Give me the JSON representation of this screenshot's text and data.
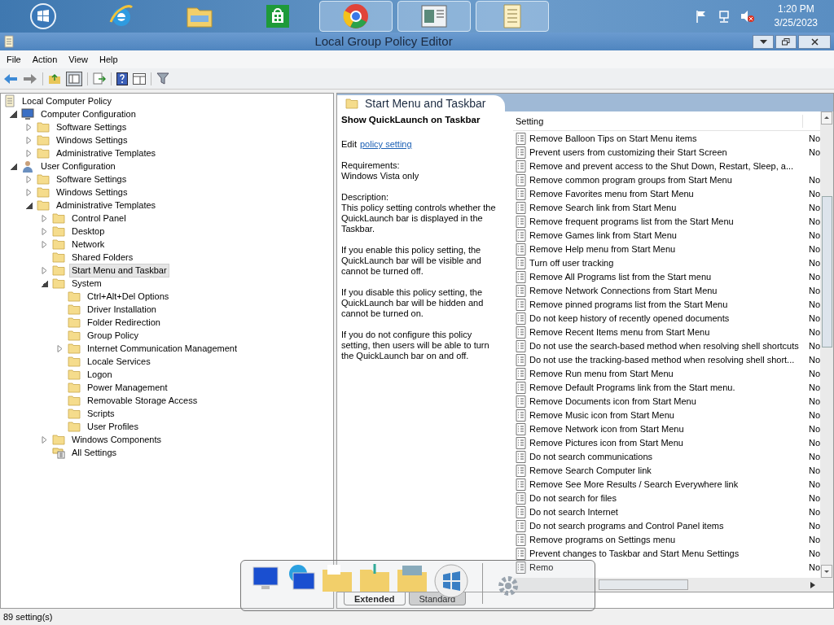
{
  "taskbar": {
    "apps": [
      {
        "kind": "orb",
        "selected": false
      },
      {
        "kind": "browser-e",
        "selected": false
      },
      {
        "kind": "folder",
        "selected": false
      },
      {
        "kind": "store",
        "selected": false
      },
      {
        "kind": "chrome",
        "selected": true
      },
      {
        "kind": "window",
        "selected": true
      },
      {
        "kind": "document",
        "selected": true
      }
    ],
    "time": "1:20 PM",
    "date": "3/25/2023"
  },
  "window": {
    "title": "Local Group Policy Editor"
  },
  "menu": [
    "File",
    "Action",
    "View",
    "Help"
  ],
  "tree": [
    {
      "label": "Local Computer Policy",
      "kind": "policy",
      "selected": false,
      "children": [
        {
          "label": "Computer Configuration",
          "kind": "computer",
          "expandable": true,
          "expanded": true,
          "selected": false,
          "children": [
            {
              "label": "Software Settings",
              "kind": "folder",
              "expandable": true,
              "expanded": false,
              "selected": false
            },
            {
              "label": "Windows Settings",
              "kind": "folder",
              "expandable": true,
              "expanded": false,
              "selected": false
            },
            {
              "label": "Administrative Templates",
              "kind": "folder",
              "expandable": true,
              "expanded": false,
              "selected": false
            }
          ]
        },
        {
          "label": "User Configuration",
          "kind": "user",
          "expandable": true,
          "expanded": true,
          "selected": false,
          "children": [
            {
              "label": "Software Settings",
              "kind": "folder",
              "expandable": true,
              "expanded": false,
              "selected": false
            },
            {
              "label": "Windows Settings",
              "kind": "folder",
              "expandable": true,
              "expanded": false,
              "selected": false
            },
            {
              "label": "Administrative Templates",
              "kind": "folder",
              "expandable": true,
              "expanded": true,
              "selected": false,
              "children": [
                {
                  "label": "Control Panel",
                  "kind": "folder",
                  "expandable": true,
                  "expanded": false,
                  "selected": false
                },
                {
                  "label": "Desktop",
                  "kind": "folder",
                  "expandable": true,
                  "expanded": false,
                  "selected": false
                },
                {
                  "label": "Network",
                  "kind": "folder",
                  "expandable": true,
                  "expanded": false,
                  "selected": false
                },
                {
                  "label": "Shared Folders",
                  "kind": "folder",
                  "expandable": false,
                  "expanded": false,
                  "selected": false
                },
                {
                  "label": "Start Menu and Taskbar",
                  "kind": "folder",
                  "expandable": true,
                  "expanded": false,
                  "selected": true
                },
                {
                  "label": "System",
                  "kind": "folder",
                  "expandable": true,
                  "expanded": true,
                  "selected": false,
                  "children": [
                    {
                      "label": "Ctrl+Alt+Del Options",
                      "kind": "folder",
                      "expandable": false,
                      "expanded": false,
                      "selected": false
                    },
                    {
                      "label": "Driver Installation",
                      "kind": "folder",
                      "expandable": false,
                      "expanded": false,
                      "selected": false
                    },
                    {
                      "label": "Folder Redirection",
                      "kind": "folder",
                      "expandable": false,
                      "expanded": false,
                      "selected": false
                    },
                    {
                      "label": "Group Policy",
                      "kind": "folder",
                      "expandable": false,
                      "expanded": false,
                      "selected": false
                    },
                    {
                      "label": "Internet Communication Management",
                      "kind": "folder",
                      "expandable": true,
                      "expanded": false,
                      "selected": false
                    },
                    {
                      "label": "Locale Services",
                      "kind": "folder",
                      "expandable": false,
                      "expanded": false,
                      "selected": false
                    },
                    {
                      "label": "Logon",
                      "kind": "folder",
                      "expandable": false,
                      "expanded": false,
                      "selected": false
                    },
                    {
                      "label": "Power Management",
                      "kind": "folder",
                      "expandable": false,
                      "expanded": false,
                      "selected": false
                    },
                    {
                      "label": "Removable Storage Access",
                      "kind": "folder",
                      "expandable": false,
                      "expanded": false,
                      "selected": false
                    },
                    {
                      "label": "Scripts",
                      "kind": "folder",
                      "expandable": false,
                      "expanded": false,
                      "selected": false
                    },
                    {
                      "label": "User Profiles",
                      "kind": "folder",
                      "expandable": false,
                      "expanded": false,
                      "selected": false
                    }
                  ]
                },
                {
                  "label": "Windows Components",
                  "kind": "folder",
                  "expandable": true,
                  "expanded": false,
                  "selected": false
                },
                {
                  "label": "All Settings",
                  "kind": "settings",
                  "expandable": false,
                  "expanded": false,
                  "selected": false
                }
              ]
            }
          ]
        }
      ]
    }
  ],
  "pane": {
    "title": "Start Menu and Taskbar",
    "detail": {
      "heading": "Show QuickLaunch on Taskbar",
      "edit_prefix": "Edit",
      "edit_link": "policy setting ",
      "requirements_label": "Requirements:",
      "requirements": "Windows Vista only",
      "description_label": "Description:",
      "paragraphs": [
        "This policy setting controls whether the QuickLaunch bar is displayed in the Taskbar.",
        "If you enable this policy setting, the QuickLaunch bar will be visible and cannot be turned off.",
        "If you disable this policy setting, the QuickLaunch bar will be hidden and cannot be turned on.",
        "If you do not configure this policy setting, then users will be able to turn the QuickLaunch bar on and off."
      ]
    },
    "columns": [
      "Setting"
    ],
    "rows": [
      {
        "setting": "Remove Balloon Tips on Start Menu items",
        "state": "No"
      },
      {
        "setting": "Prevent users from customizing their Start Screen",
        "state": "No"
      },
      {
        "setting": "Remove and prevent access to the Shut Down, Restart, Sleep, a..."
      },
      {
        "setting": "Remove common program groups from Start Menu",
        "state": "No"
      },
      {
        "setting": "Remove Favorites menu from Start Menu",
        "state": "No"
      },
      {
        "setting": "Remove Search link from Start Menu",
        "state": "No"
      },
      {
        "setting": "Remove frequent programs list from the Start Menu",
        "state": "No"
      },
      {
        "setting": "Remove Games link from Start Menu",
        "state": "No"
      },
      {
        "setting": "Remove Help menu from Start Menu",
        "state": "No"
      },
      {
        "setting": "Turn off user tracking",
        "state": "No"
      },
      {
        "setting": "Remove All Programs list from the Start menu",
        "state": "No"
      },
      {
        "setting": "Remove Network Connections from Start Menu",
        "state": "No"
      },
      {
        "setting": "Remove pinned programs list from the Start Menu",
        "state": "No"
      },
      {
        "setting": "Do not keep history of recently opened documents",
        "state": "No"
      },
      {
        "setting": "Remove Recent Items menu from Start Menu",
        "state": "No"
      },
      {
        "setting": "Do not use the search-based method when resolving shell shortcuts",
        "state": "No"
      },
      {
        "setting": "Do not use the tracking-based method when resolving shell short...",
        "state": "No"
      },
      {
        "setting": "Remove Run menu from Start Menu",
        "state": "No"
      },
      {
        "setting": "Remove Default Programs link from the Start menu.",
        "state": "No"
      },
      {
        "setting": "Remove Documents icon from Start Menu",
        "state": "No"
      },
      {
        "setting": "Remove Music icon from Start Menu",
        "state": "No"
      },
      {
        "setting": "Remove Network icon from Start Menu",
        "state": "No"
      },
      {
        "setting": "Remove Pictures icon from Start Menu",
        "state": "No"
      },
      {
        "setting": "Do not search communications",
        "state": "No"
      },
      {
        "setting": "Remove Search Computer link",
        "state": "No"
      },
      {
        "setting": "Remove See More Results / Search Everywhere link",
        "state": "No"
      },
      {
        "setting": "Do not search for files",
        "state": "No"
      },
      {
        "setting": "Do not search Internet",
        "state": "No"
      },
      {
        "setting": "Do not search programs and Control Panel items",
        "state": "No"
      },
      {
        "setting": "Remove programs on Settings menu",
        "state": "No"
      },
      {
        "setting": "Prevent changes to Taskbar and Start Menu Settings",
        "state": "No"
      },
      {
        "setting": "Remo",
        "state": "No"
      }
    ],
    "tabs": [
      {
        "label": "Extended",
        "selected": true
      },
      {
        "label": "Standard",
        "selected": false
      }
    ]
  },
  "status_bar": "89 setting(s)"
}
